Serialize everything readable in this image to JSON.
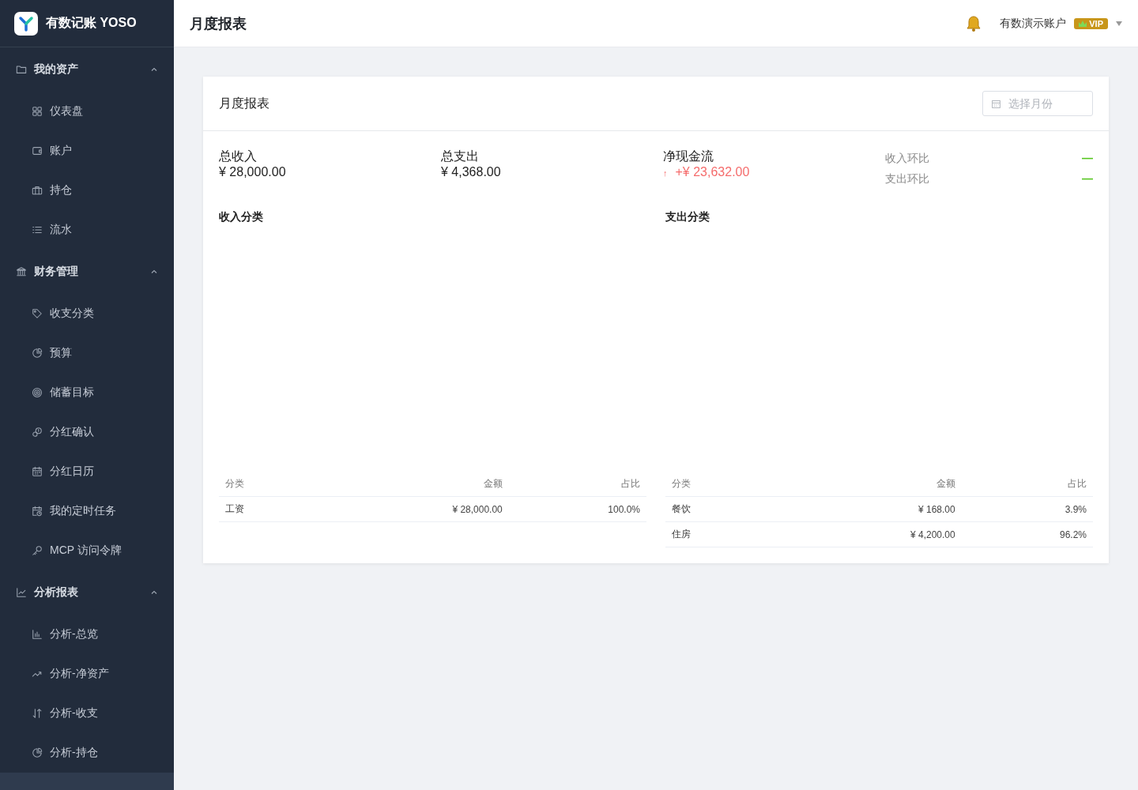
{
  "brand": {
    "name": "有数记账 YOSO"
  },
  "sidebar": {
    "groups": [
      {
        "label": "我的资产",
        "expanded": true,
        "items": [
          {
            "label": "仪表盘",
            "selected": false
          },
          {
            "label": "账户",
            "selected": false
          },
          {
            "label": "持仓",
            "selected": false
          },
          {
            "label": "流水",
            "selected": false
          }
        ]
      },
      {
        "label": "财务管理",
        "expanded": true,
        "items": [
          {
            "label": "收支分类",
            "selected": false
          },
          {
            "label": "预算",
            "selected": false
          },
          {
            "label": "储蓄目标",
            "selected": false
          },
          {
            "label": "分红确认",
            "selected": false
          },
          {
            "label": "分红日历",
            "selected": false
          },
          {
            "label": "我的定时任务",
            "selected": false
          },
          {
            "label": "MCP 访问令牌",
            "selected": false
          }
        ]
      },
      {
        "label": "分析报表",
        "expanded": true,
        "items": [
          {
            "label": "分析-总览",
            "selected": false
          },
          {
            "label": "分析-净资产",
            "selected": false
          },
          {
            "label": "分析-收支",
            "selected": false
          },
          {
            "label": "分析-持仓",
            "selected": false
          }
        ]
      }
    ],
    "cut_item": {
      "selected": true
    }
  },
  "header": {
    "title": "月度报表",
    "user": "有数演示账户",
    "badge": "VIP"
  },
  "card": {
    "title": "月度报表",
    "month_picker": {
      "placeholder": "选择月份"
    },
    "stats": [
      {
        "label": "总收入",
        "value": "¥ 28,000.00"
      },
      {
        "label": "总支出",
        "value": "¥ 4,368.00"
      },
      {
        "label": "净现金流",
        "value": "+¥ 23,632.00",
        "arrow": "↑",
        "kind": "positive"
      }
    ],
    "comparisons": [
      {
        "label": "收入环比",
        "value": "—"
      },
      {
        "label": "支出环比",
        "value": "—"
      }
    ],
    "tables": [
      {
        "title": "收入分类",
        "columns": [
          "分类",
          "金额",
          "占比"
        ],
        "rows": [
          [
            "工资",
            "¥ 28,000.00",
            "100.0%"
          ]
        ]
      },
      {
        "title": "支出分类",
        "columns": [
          "分类",
          "金额",
          "占比"
        ],
        "rows": [
          [
            "餐饮",
            "¥ 168.00",
            "3.9%"
          ],
          [
            "住房",
            "¥ 4,200.00",
            "96.2%"
          ]
        ]
      }
    ]
  }
}
